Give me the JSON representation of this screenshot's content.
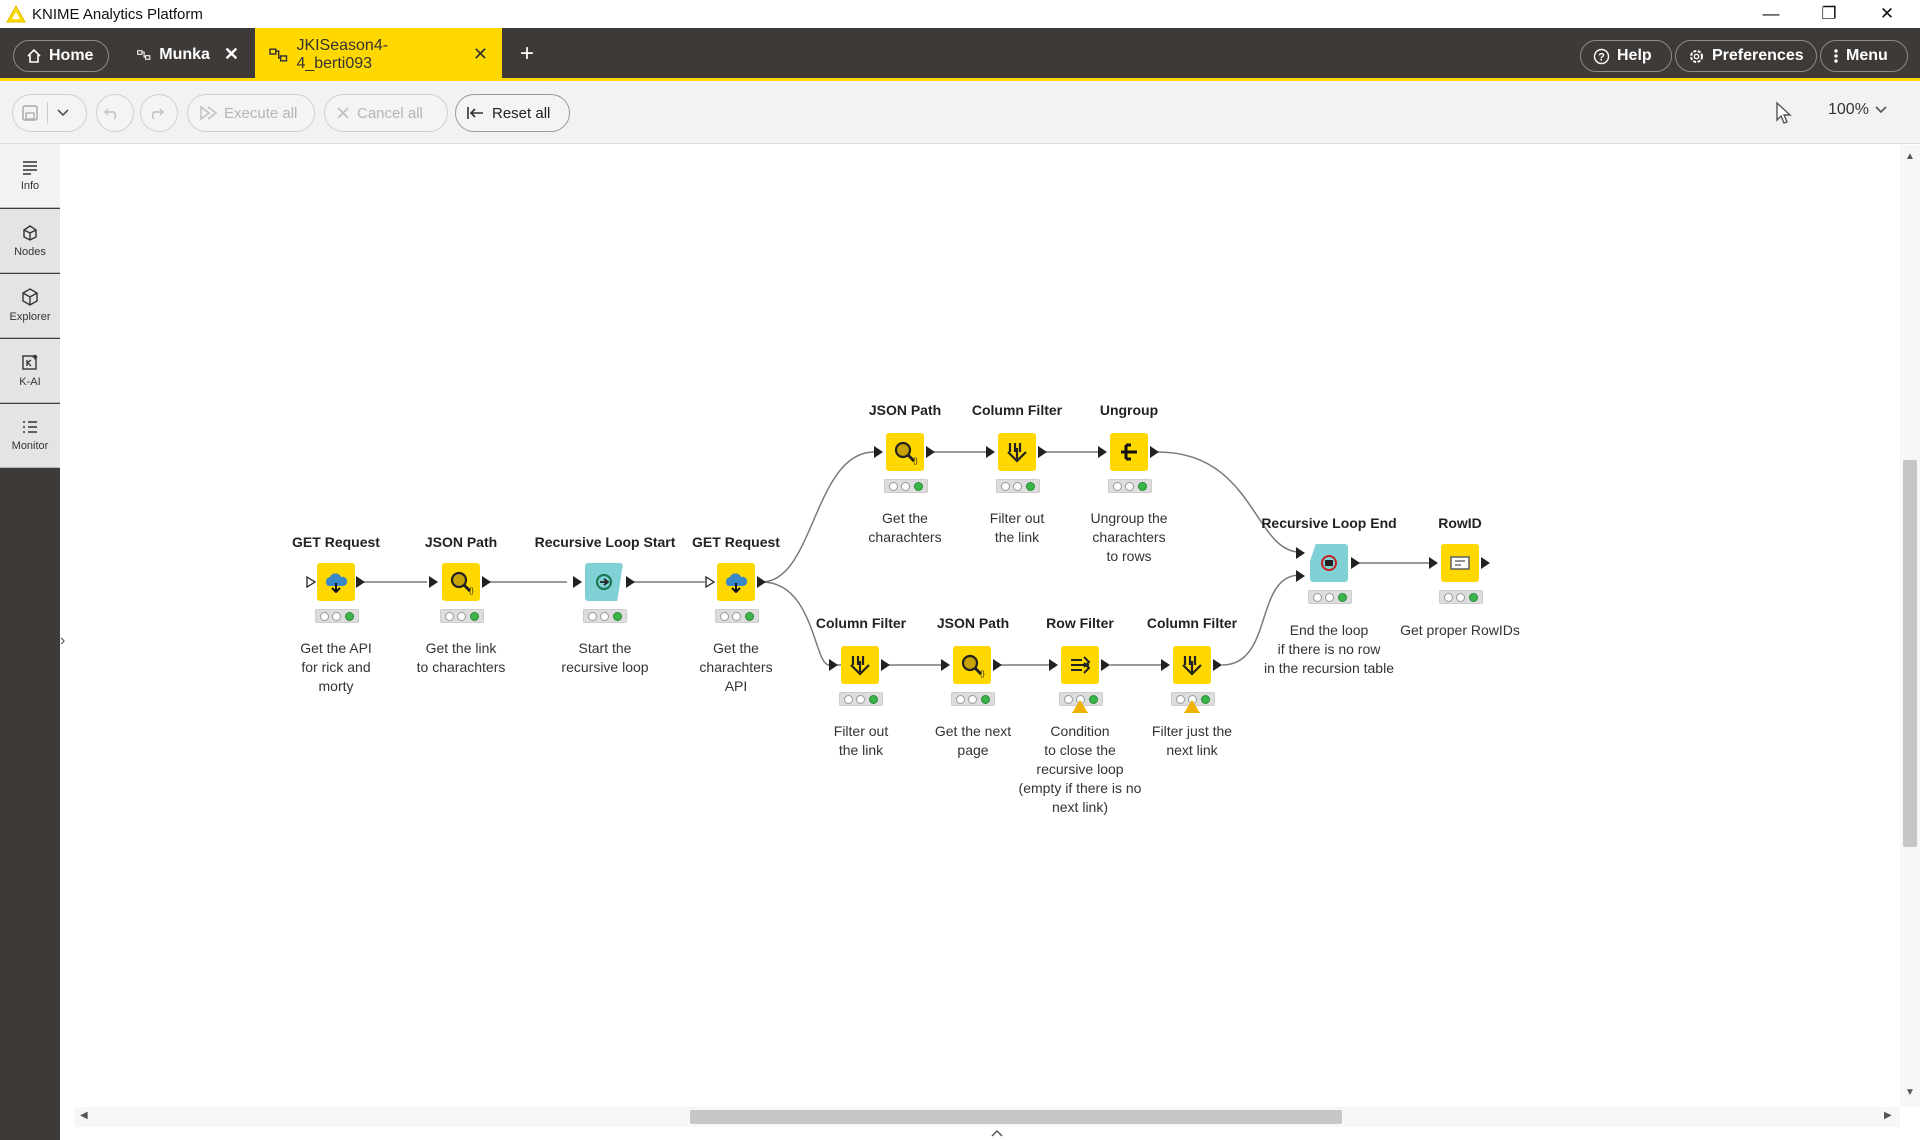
{
  "window": {
    "title": "KNIME Analytics Platform",
    "controls": [
      "minimize-icon",
      "restore-icon",
      "close-icon"
    ]
  },
  "tabs": {
    "home_label": "Home",
    "items": [
      {
        "label": "Munka",
        "close": "✕",
        "active": false
      },
      {
        "label": "JKISeason4-4_berti093",
        "close": "✕",
        "active": true
      }
    ],
    "add_label": "+"
  },
  "topright": {
    "help": "Help",
    "preferences": "Preferences",
    "menu": "Menu"
  },
  "toolbar": {
    "execute_all": "Execute all",
    "cancel_all": "Cancel all",
    "reset_all": "Reset all",
    "zoom": "100%"
  },
  "sidebar": {
    "items": [
      "Info",
      "Nodes",
      "Explorer",
      "K-AI",
      "Monitor"
    ]
  },
  "colors": {
    "accent": "#ffd800",
    "dark": "#3d3a38",
    "teal_node": "#7fd1d6",
    "status_green": "#3bb54a"
  },
  "workflow": {
    "nodes": [
      {
        "title": "GET Request",
        "label": "Get the API\nfor rick and\nmorty",
        "icon": "cloud-download-icon",
        "status": "executed"
      },
      {
        "title": "JSON Path",
        "label": "Get the link\nto charachters",
        "icon": "magnifier-icon",
        "status": "executed"
      },
      {
        "title": "Recursive Loop Start",
        "label": "Start the\nrecursive loop",
        "icon": "loop-start-icon",
        "status": "executed"
      },
      {
        "title": "GET Request",
        "label": "Get the\ncharachters\nAPI",
        "icon": "cloud-download-icon",
        "status": "executed"
      },
      {
        "title": "JSON Path",
        "label": "Get the\ncharachters",
        "icon": "magnifier-icon",
        "status": "executed"
      },
      {
        "title": "Column Filter",
        "label": "Filter out\nthe link",
        "icon": "column-filter-icon",
        "status": "executed"
      },
      {
        "title": "Ungroup",
        "label": "Ungroup the\ncharachters\nto rows",
        "icon": "ungroup-icon",
        "status": "executed"
      },
      {
        "title": "Column Filter",
        "label": "Filter out\nthe link",
        "icon": "column-filter-icon",
        "status": "executed"
      },
      {
        "title": "JSON Path",
        "label": "Get the next\npage",
        "icon": "magnifier-icon",
        "status": "executed"
      },
      {
        "title": "Row Filter",
        "label": "Condition\nto close the\nrecursive loop\n(empty if there is no\nnext link)",
        "icon": "row-filter-icon",
        "status": "warning"
      },
      {
        "title": "Column Filter",
        "label": "Filter just the\nnext link",
        "icon": "column-filter-icon",
        "status": "warning"
      },
      {
        "title": "Recursive Loop End",
        "label": "End the loop\nif there is no row\nin the recursion table",
        "icon": "loop-end-icon",
        "status": "executed"
      },
      {
        "title": "RowID",
        "label": "Get proper RowIDs",
        "icon": "rowid-icon",
        "status": "executed"
      }
    ]
  }
}
